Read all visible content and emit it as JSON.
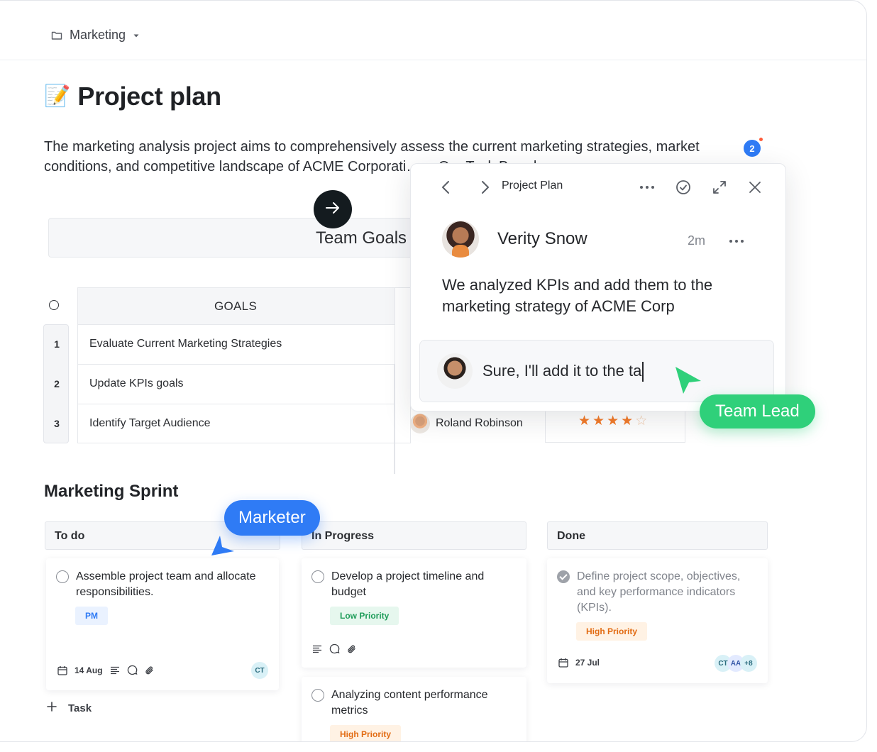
{
  "workspace": {
    "name": "Marketing"
  },
  "page": {
    "emoji": "📝",
    "title": "Project plan",
    "description": "The marketing analysis project aims to comprehensively assess the current marketing strategies, market conditions, and competitive landscape of ACME Corporati… …Our Task Board."
  },
  "notifications": {
    "count": "2"
  },
  "team_goals": {
    "title": "Team Goals",
    "columns": [
      "GOALS"
    ],
    "row_numbers": [
      "1",
      "2",
      "3"
    ],
    "rows": [
      {
        "goal": "Evaluate Current Marketing Strategies"
      },
      {
        "goal": "Update KPIs goals"
      },
      {
        "goal": "Identify Target Audience",
        "assignee": "Roland Robinson",
        "rating": 4,
        "rating_max": 5
      }
    ]
  },
  "comment_popup": {
    "title": "Project Plan",
    "author": "Verity Snow",
    "time": "2m",
    "message": "We analyzed KPIs and add them to the marketing strategy of ACME Corp",
    "reply_draft": "Sure, I'll add it to the ta",
    "icons": [
      "back-icon",
      "forward-icon",
      "more-icon",
      "check-circle-icon",
      "expand-icon",
      "close-icon",
      "send-icon"
    ]
  },
  "presence": {
    "team_lead_label": "Team Lead",
    "marketer_label": "Marketer",
    "colors": {
      "team_lead": "#2fd07a",
      "marketer": "#2f7bf5"
    }
  },
  "sprint": {
    "title": "Marketing Sprint",
    "columns": [
      {
        "name": "To do",
        "cards": [
          {
            "text": "Assemble project team and allocate responsibilities.",
            "tag": "PM",
            "date": "14 Aug",
            "assignees": [
              "CT"
            ]
          }
        ]
      },
      {
        "name": "In Progress",
        "cards": [
          {
            "text": "Develop a project timeline and budget",
            "tag": "Low Priority"
          },
          {
            "text": "Analyzing content performance metrics",
            "tag": "High Priority"
          }
        ]
      },
      {
        "name": "Done",
        "cards": [
          {
            "text": "Define project scope, objectives, and key performance indicators (KPIs).",
            "tag": "High Priority",
            "date": "27 Jul",
            "assignees": [
              "CT",
              "AA"
            ],
            "extra_assignees": "+8",
            "done": true
          }
        ]
      }
    ],
    "add_task_label": "Task"
  }
}
